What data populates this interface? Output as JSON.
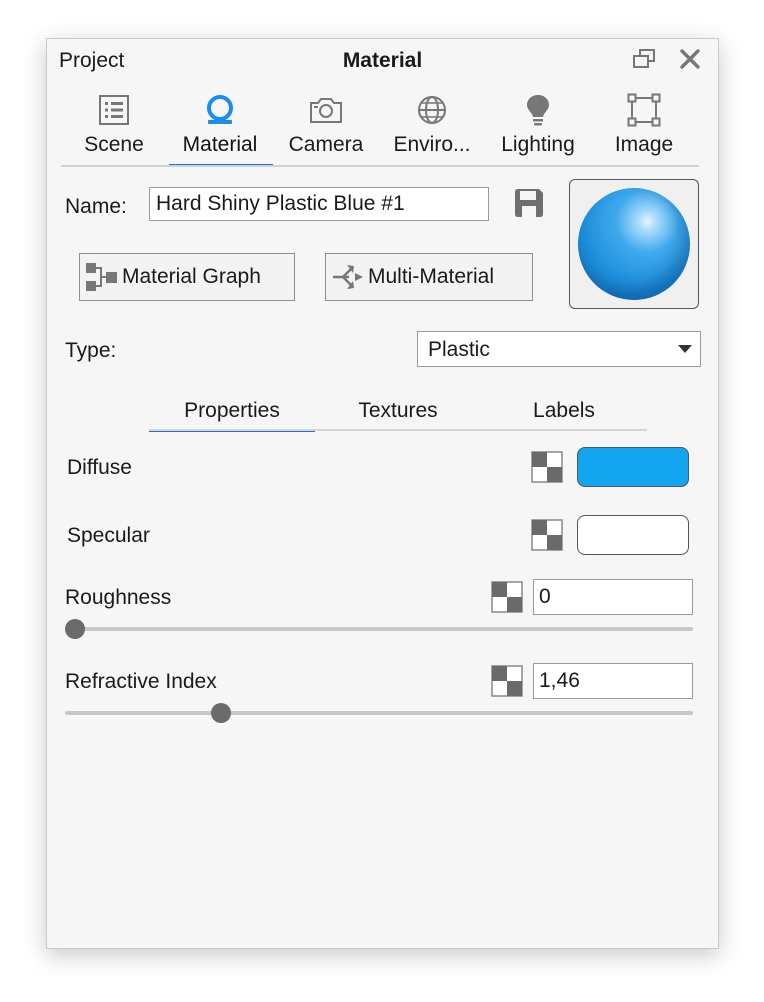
{
  "window": {
    "left_title": "Project",
    "center_title": "Material"
  },
  "top_tabs": [
    {
      "label": "Scene",
      "icon": "list-icon"
    },
    {
      "label": "Material",
      "icon": "material-icon",
      "active": true
    },
    {
      "label": "Camera",
      "icon": "camera-icon"
    },
    {
      "label": "Enviro...",
      "icon": "globe-icon"
    },
    {
      "label": "Lighting",
      "icon": "bulb-icon"
    },
    {
      "label": "Image",
      "icon": "frame-icon"
    }
  ],
  "name": {
    "label": "Name:",
    "value": "Hard Shiny Plastic Blue #1"
  },
  "buttons": {
    "material_graph": "Material Graph",
    "multi_material": "Multi-Material"
  },
  "type": {
    "label": "Type:",
    "value": "Plastic"
  },
  "sub_tabs": [
    "Properties",
    "Textures",
    "Labels"
  ],
  "properties": {
    "diffuse": {
      "label": "Diffuse",
      "color": "#13a6f0"
    },
    "specular": {
      "label": "Specular",
      "color": "#ffffff"
    },
    "roughness": {
      "label": "Roughness",
      "value": "0",
      "slider_fraction": 0.0
    },
    "refractive_index": {
      "label": "Refractive Index",
      "value": "1,46",
      "slider_fraction": 0.24
    }
  },
  "colors": {
    "accent": "#1a73e8",
    "material_icon": "#1a8ef0"
  }
}
